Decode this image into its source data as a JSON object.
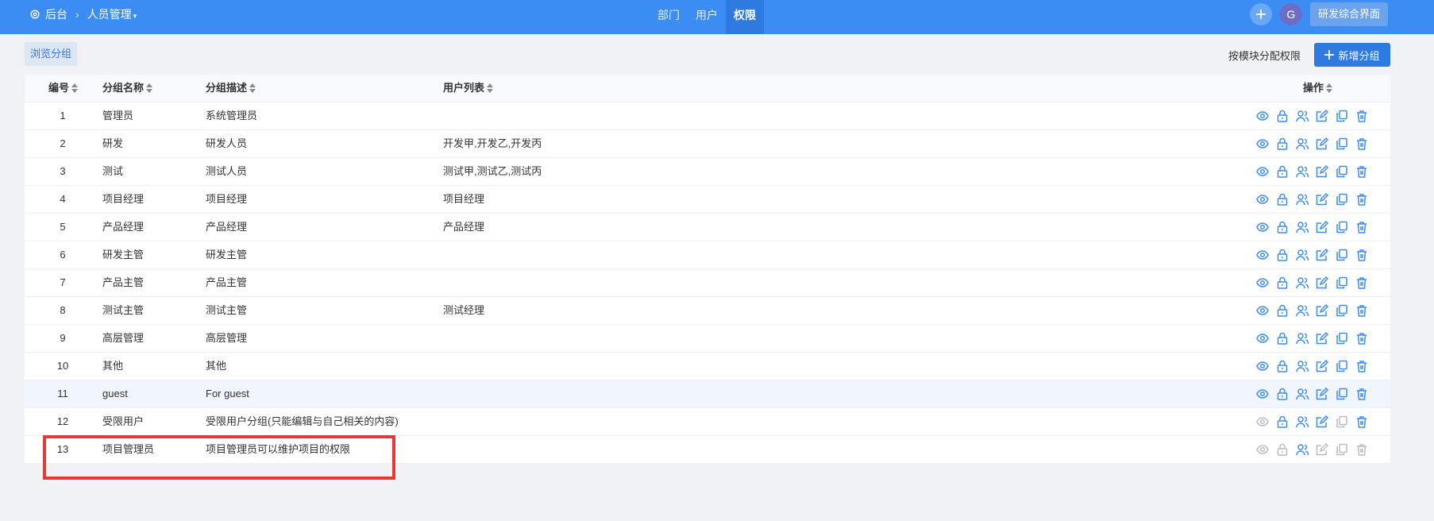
{
  "topbar": {
    "home_label": "后台",
    "section_label": "人员管理",
    "tabs": [
      {
        "label": "部门",
        "active": false
      },
      {
        "label": "用户",
        "active": false
      },
      {
        "label": "权限",
        "active": true
      }
    ],
    "avatar_letter": "G",
    "dev_button": "研发综合界面"
  },
  "toolbar": {
    "browse_tab": "浏览分组",
    "assign_link": "按模块分配权限",
    "add_button": "新增分组"
  },
  "table": {
    "headers": {
      "id": "编号",
      "name": "分组名称",
      "desc": "分组描述",
      "users": "用户列表",
      "ops": "操作"
    },
    "rows": [
      {
        "id": "1",
        "name": "管理员",
        "desc": "系统管理员",
        "users": ""
      },
      {
        "id": "2",
        "name": "研发",
        "desc": "研发人员",
        "users": "开发甲,开发乙,开发丙"
      },
      {
        "id": "3",
        "name": "测试",
        "desc": "测试人员",
        "users": "测试甲,测试乙,测试丙"
      },
      {
        "id": "4",
        "name": "项目经理",
        "desc": "项目经理",
        "users": "项目经理"
      },
      {
        "id": "5",
        "name": "产品经理",
        "desc": "产品经理",
        "users": "产品经理"
      },
      {
        "id": "6",
        "name": "研发主管",
        "desc": "研发主管",
        "users": ""
      },
      {
        "id": "7",
        "name": "产品主管",
        "desc": "产品主管",
        "users": ""
      },
      {
        "id": "8",
        "name": "测试主管",
        "desc": "测试主管",
        "users": "测试经理"
      },
      {
        "id": "9",
        "name": "高层管理",
        "desc": "高层管理",
        "users": ""
      },
      {
        "id": "10",
        "name": "其他",
        "desc": "其他",
        "users": ""
      },
      {
        "id": "11",
        "name": "guest",
        "desc": "For guest",
        "users": ""
      },
      {
        "id": "12",
        "name": "受限用户",
        "desc": "受限用户分组(只能编辑与自己相关的内容)",
        "users": ""
      },
      {
        "id": "13",
        "name": "项目管理员",
        "desc": "项目管理员可以维护项目的权限",
        "users": ""
      }
    ]
  },
  "row_ops": [
    "view-icon",
    "lock-icon",
    "users-icon",
    "edit-icon",
    "copy-icon",
    "delete-icon"
  ],
  "colors": {
    "primary": "#3b8cf3",
    "highlight_box": "#e53935",
    "row_highlight": "#f1f6fe"
  }
}
